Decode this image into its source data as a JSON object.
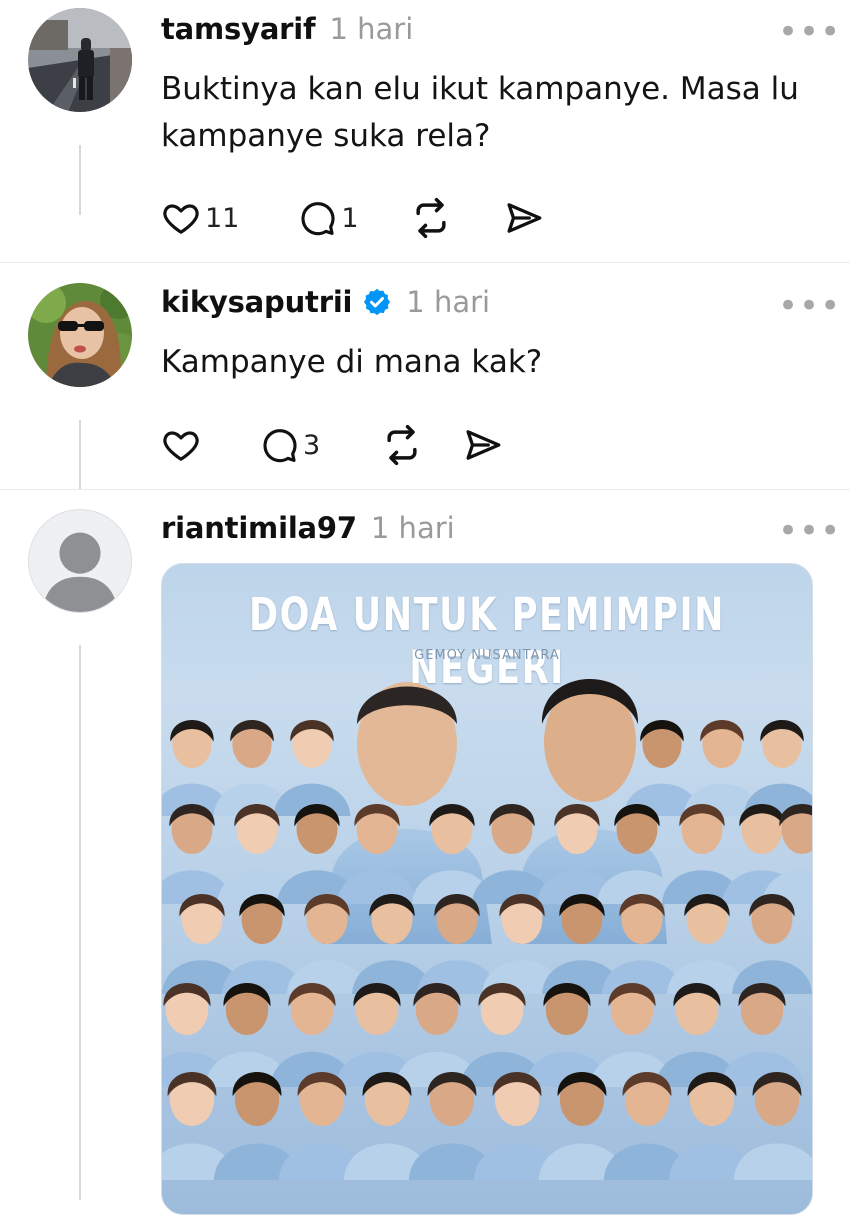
{
  "posts": [
    {
      "username": "tamsyarif",
      "time": "1 hari",
      "text": "Buktinya kan elu ikut kampanye. Masa lu kampanye suka rela?",
      "text_line1": "Buktinya kan elu ikut kampanye. Masa lu",
      "text_line2": "kampanye suka rela?",
      "likes": "11",
      "replies": "1",
      "verified": false,
      "avatar_icon": "street-photo-avatar"
    },
    {
      "username": "kikysaputrii",
      "time": "1 hari",
      "text": "Kampanye di mana kak?",
      "likes": "",
      "replies": "3",
      "verified": true,
      "avatar_icon": "selfie-photo-avatar"
    },
    {
      "username": "riantimila97",
      "time": "1 hari",
      "verified": false,
      "avatar_icon": "default-user-avatar",
      "image": {
        "title": "DOA UNTUK PEMIMPIN NEGERI",
        "subtitle": "GEMOY NUSANTARA"
      }
    }
  ],
  "more_label": "•••",
  "colors": {
    "text": "#101010",
    "muted": "#9a9a9a",
    "verified": "#0095f6",
    "thread_line": "#d8d8d8"
  }
}
